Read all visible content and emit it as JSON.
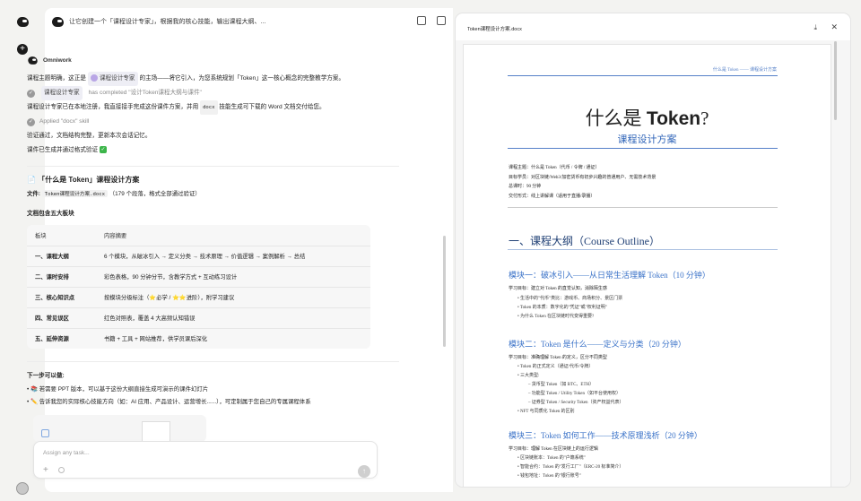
{
  "chat": {
    "title": "让它创建一个「课程设计专家」，根据我的核心技能，输出课程大纲、...",
    "sender": "Omniwork",
    "intro_1": "课程主题明确，这正是",
    "intro_pill": "课程设计专家",
    "intro_2": "的主场——将它引入，为您系统规划「Token」这一核心概念的完整教学方案。",
    "completed_pill": "课程设计专家",
    "completed_text": "has completed \"设计Token课程大纲与课件\"",
    "registered_1": "课程设计专家已在本地注册，我直接接手完成这份课件方案，并用",
    "registered_code": "docx",
    "registered_2": "技能生成可下载的 Word 文档交付给您。",
    "applied": "Applied \"docx\" skill",
    "verify": "验证通过，文档结构完整，更新本次会话记忆。",
    "generated": "课件已生成并通过格式验证",
    "heading": "「什么是 Token」课程设计方案",
    "file_label": "文件:",
    "file_code": "Token课程设计方案.docx",
    "file_info": "（179 个段落，格式全部通过验证）",
    "sections_title": "文档包含五大板块",
    "table_headers": [
      "板块",
      "内容摘要"
    ],
    "table_rows": [
      {
        "k": "一、课程大纲",
        "v": "6 个模块，从破冰引入 → 定义分类 → 技术原理 → 价值逻辑 → 案例解析 → 总结"
      },
      {
        "k": "二、课时安排",
        "v": "彩色表格，90 分钟分节，含教学方式 + 互动练习设计"
      },
      {
        "k": "三、核心知识点",
        "v": "按模块分级标注（⭐必学 / ⭐⭐进阶），附学习建议"
      },
      {
        "k": "四、常见误区",
        "v": "红色对照表，覆盖 4 大高频认知错误"
      },
      {
        "k": "五、延伸资源",
        "v": "书籍 + 工具 + 网站推荐，供学员课后深化"
      }
    ],
    "next_title": "下一步可以做:",
    "next_1": "• 📚 若需要 PPT 版本，可以基于这份大纲直接生成可演示的课件幻灯片",
    "next_2": "• ✏️ 告诉我您的实际核心技能方向（如：AI 应用、产品设计、运营增长......），可定制属于您自己的专属课程体系",
    "composer_placeholder": "Assign any task..."
  },
  "doc": {
    "filename": "Token课程设计方案.docx",
    "header_text": "什么是 Token —— 课程设计方案",
    "title_cn": "什么是",
    "title_en": "Token",
    "title_q": "?",
    "subtitle": "课程设计方案",
    "meta": [
      "课程主题：什么是 Token（代币 / 令牌 / 通证）",
      "目标学员：对区块链/Web3/加密货币有初步兴趣的普通用户、无需技术背景",
      "总课时：90 分钟",
      "交付形式：线上讲解课（适用于直播/录播）"
    ],
    "section": "一、课程大纲（Course Outline）",
    "mod1": "模块一：破冰引入——从日常生活理解 Token（10 分钟）",
    "mod1_goal": "学习目标：建立对 Token 的直觉认知，消除陌生感",
    "mod1_items": [
      "生活中的\"代币\"类比：游戏币、商场积分、景区门票",
      "Token 的本质：数字化的\"凭证\"或\"权利证明\"",
      "为什么 Token 在区块链时代变得重要?"
    ],
    "mod2": "模块二：Token 是什么——定义与分类（20 分钟）",
    "mod2_goal": "学习目标：准确理解 Token 的定义，区分不同类型",
    "mod2_items": [
      "Token 的正式定义（通证/代币/令牌）",
      "三大类型:"
    ],
    "mod2_sub": [
      "– 货币型 Token（如 BTC、ETH）",
      "– 功能型 Token / Utility Token（如平台使用权）",
      "– 证券型 Token / Security Token（资产权益代表）"
    ],
    "mod2_last": "NFT 与同质化 Token 的区别",
    "mod3": "模块三：Token 如何工作——技术原理浅析（20 分钟）",
    "mod3_goal": "学习目标：理解 Token 在区块链上的运行逻辑",
    "mod3_items": [
      "区块链账本：Token 的\"户籍系统\"",
      "智能合约：Token 的\"发行工厂\"（ERC-20 标准简介）",
      "钱包地址：Token 的\"银行账号\""
    ]
  }
}
